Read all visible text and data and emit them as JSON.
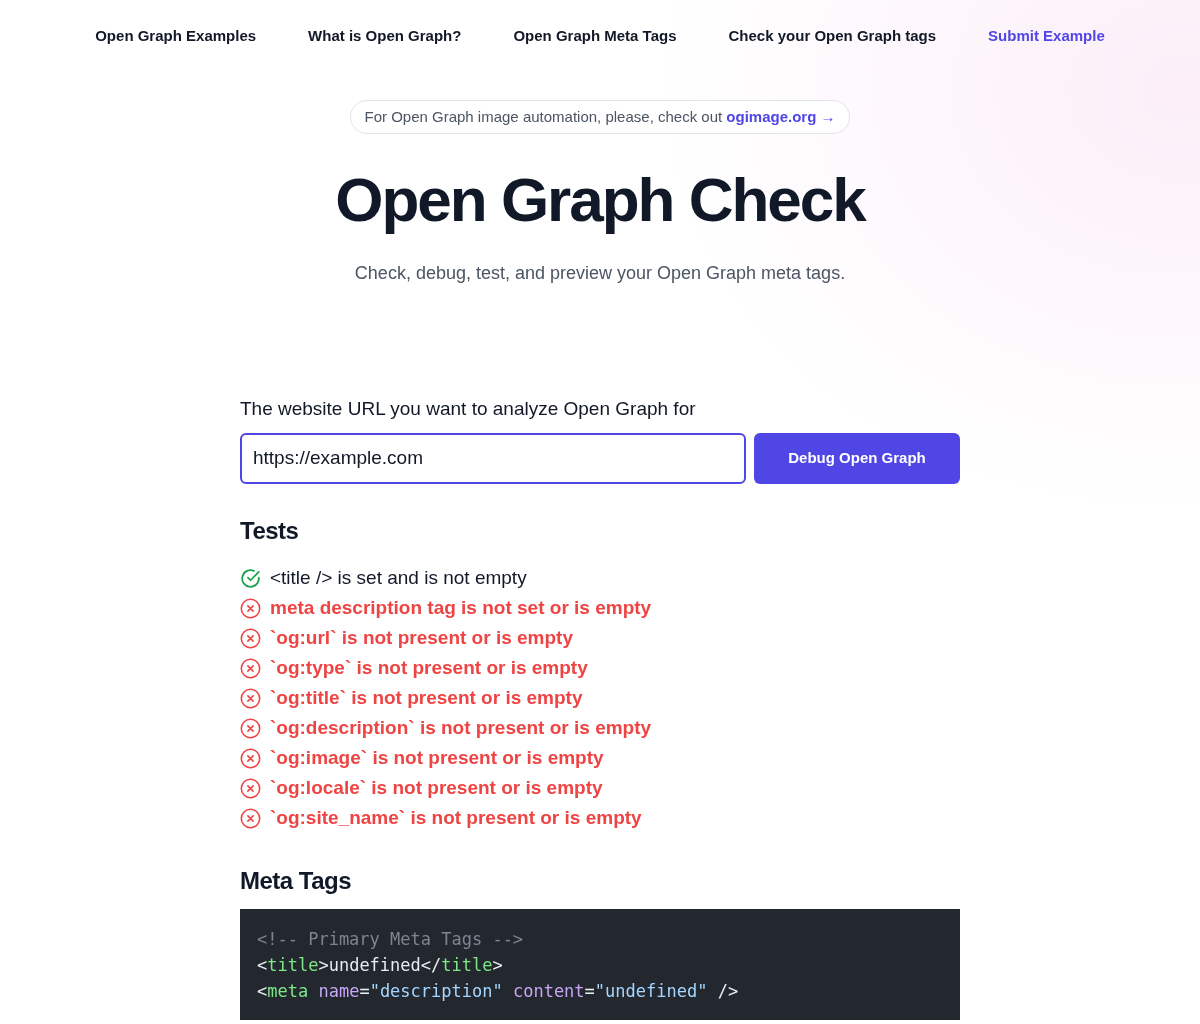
{
  "nav": {
    "items": [
      {
        "label": "Open Graph Examples",
        "highlighted": false
      },
      {
        "label": "What is Open Graph?",
        "highlighted": false
      },
      {
        "label": "Open Graph Meta Tags",
        "highlighted": false
      },
      {
        "label": "Check your Open Graph tags",
        "highlighted": false
      },
      {
        "label": "Submit Example",
        "highlighted": true
      }
    ]
  },
  "banner": {
    "text": "For Open Graph image automation, please, check out",
    "link": "ogimage.org →"
  },
  "hero": {
    "title": "Open Graph Check",
    "subtitle": "Check, debug, test, and preview your Open Graph meta tags."
  },
  "url_form": {
    "label": "The website URL you want to analyze Open Graph for",
    "value": "https://example.com",
    "button": "Debug Open Graph"
  },
  "tests": {
    "heading": "Tests",
    "items": [
      {
        "text": "<title /> is set and is not empty",
        "passed": true
      },
      {
        "text": "meta description tag is not set or is empty",
        "passed": false
      },
      {
        "text": "`og:url` is not present or is empty",
        "passed": false
      },
      {
        "text": "`og:type` is not present or is empty",
        "passed": false
      },
      {
        "text": "`og:title` is not present or is empty",
        "passed": false
      },
      {
        "text": "`og:description` is not present or is empty",
        "passed": false
      },
      {
        "text": "`og:image` is not present or is empty",
        "passed": false
      },
      {
        "text": "`og:locale` is not present or is empty",
        "passed": false
      },
      {
        "text": "`og:site_name` is not present or is empty",
        "passed": false
      }
    ]
  },
  "meta_tags": {
    "heading": "Meta Tags",
    "code_lines": [
      [
        {
          "kind": "comment",
          "text": "<!-- Primary Meta Tags -->"
        }
      ],
      [
        {
          "kind": "punct",
          "text": "<"
        },
        {
          "kind": "tag",
          "text": "title"
        },
        {
          "kind": "punct",
          "text": ">undefined</"
        },
        {
          "kind": "tag",
          "text": "title"
        },
        {
          "kind": "punct",
          "text": ">"
        }
      ],
      [
        {
          "kind": "punct",
          "text": "<"
        },
        {
          "kind": "tag",
          "text": "meta"
        },
        {
          "kind": "attr",
          "text": " name"
        },
        {
          "kind": "punct",
          "text": "="
        },
        {
          "kind": "string",
          "text": "\"description\""
        },
        {
          "kind": "attr",
          "text": " content"
        },
        {
          "kind": "punct",
          "text": "="
        },
        {
          "kind": "string",
          "text": "\"undefined\""
        },
        {
          "kind": "punct",
          "text": " />"
        }
      ]
    ]
  }
}
